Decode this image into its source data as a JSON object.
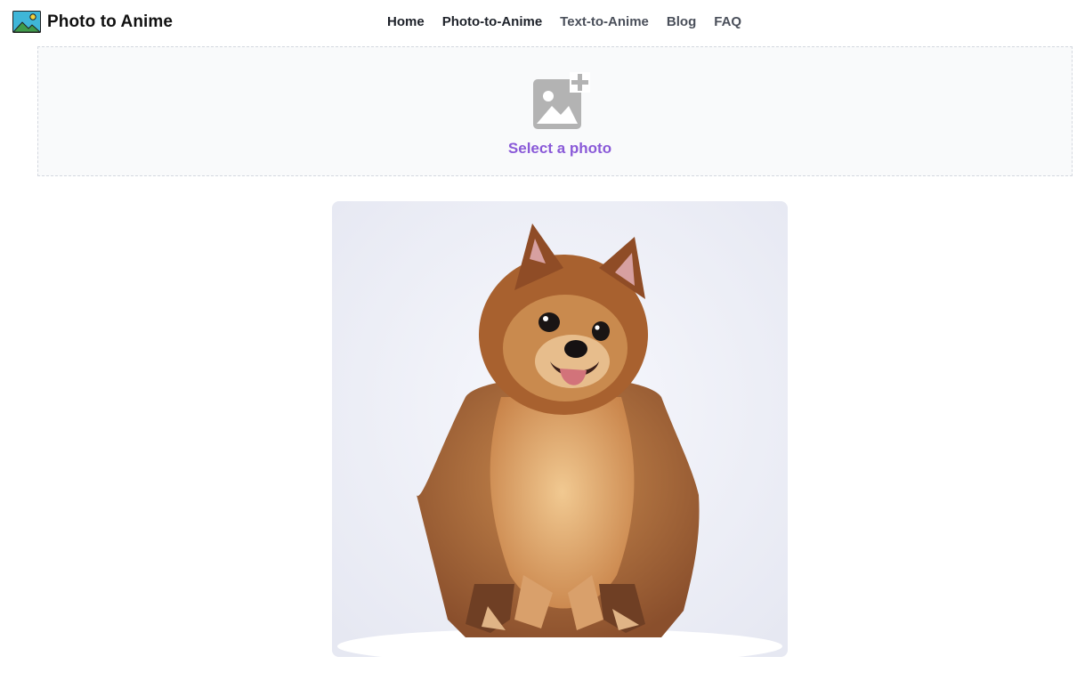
{
  "header": {
    "brand_name": "Photo to Anime",
    "brand_icon": "landscape-image-icon",
    "nav": [
      {
        "label": "Home",
        "active": true
      },
      {
        "label": "Photo-to-Anime",
        "active": true
      },
      {
        "label": "Text-to-Anime",
        "active": false
      },
      {
        "label": "Blog",
        "active": false
      },
      {
        "label": "FAQ",
        "active": false
      }
    ]
  },
  "upload": {
    "icon": "add-image-icon",
    "label": "Select a photo"
  },
  "preview": {
    "subject": "anime-style-pomeranian-image"
  },
  "colors": {
    "accent": "#8a5ad8",
    "nav_text": "#4a4f5a",
    "dropzone_bg": "#f9fafb",
    "dropzone_border": "#d4d8df"
  }
}
